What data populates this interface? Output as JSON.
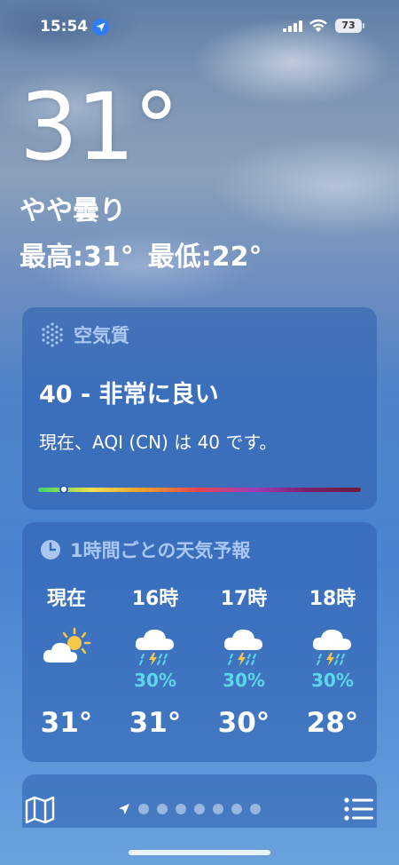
{
  "status_bar": {
    "time": "15:54",
    "battery": "73",
    "icons": [
      "location-arrow-icon",
      "cellular-signal-icon",
      "wifi-icon",
      "battery-icon"
    ]
  },
  "current": {
    "temperature": "31°",
    "condition": "やや曇り",
    "high": "最高:31°",
    "low": "最低:22°"
  },
  "air_quality": {
    "title": "空気質",
    "icon": "air-quality-icon",
    "value_label": "40 - 非常に良い",
    "description": "現在、AQI (CN) は 40 です。",
    "level": 0.08,
    "gradient_colors": [
      "#3dd66a",
      "#f4e04a",
      "#f39a2f",
      "#e6434f",
      "#a23cb8",
      "#7d1f6a",
      "#6d1c3a"
    ]
  },
  "hourly": {
    "title": "1時間ごとの天気予報",
    "icon": "clock-icon",
    "hours": [
      {
        "label": "現在",
        "icon": "partly-cloudy-sun-icon",
        "pop": "",
        "temp": "31°"
      },
      {
        "label": "16時",
        "icon": "thunderstorm-rain-icon",
        "pop": "30%",
        "temp": "31°"
      },
      {
        "label": "17時",
        "icon": "thunderstorm-rain-icon",
        "pop": "30%",
        "temp": "30°"
      },
      {
        "label": "18時",
        "icon": "thunderstorm-rain-icon",
        "pop": "30%",
        "temp": "28°"
      }
    ],
    "pop_color": "#5cd6e8"
  },
  "tab_bar": {
    "map_icon": "map-icon",
    "list_icon": "list-icon",
    "page_dots": 7,
    "current_location_icon": "location-arrow-icon"
  }
}
